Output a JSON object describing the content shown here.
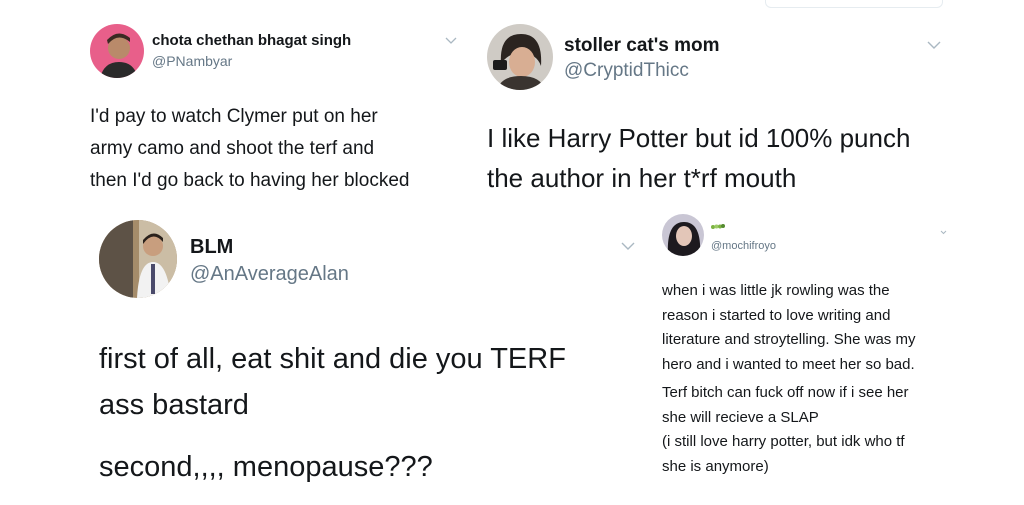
{
  "tweets": [
    {
      "name": "chota chethan bhagat singh",
      "handle": "@PNambyar",
      "lines": [
        "I'd pay to watch Clymer put on her",
        "army camo and shoot the terf and",
        "then I'd go back to having her blocked"
      ]
    },
    {
      "name": "stoller cat's mom",
      "handle": "@CryptidThicc",
      "lines": [
        "I like Harry Potter but id 100% punch",
        "the author in her t*rf mouth"
      ]
    },
    {
      "name": "BLM",
      "handle": "@AnAverageAlan",
      "lines": [
        "first of all, eat shit and die you TERF",
        "ass bastard",
        "second,,,, menopause???"
      ]
    },
    {
      "name": "",
      "handle": "@mochifroyo",
      "lines": [
        "when i was little jk rowling was the",
        "reason i started to love writing and",
        "literature and stroytelling. She was my",
        "hero and i wanted to meet her so bad.",
        "Terf bitch can fuck off now if i see her",
        "she will recieve a SLAP",
        "(i still love harry potter, but idk who tf",
        "she is anymore)"
      ]
    }
  ],
  "icons": {
    "chevron": "chevron-down-icon",
    "emoji": "caterpillar-emoji-icon"
  }
}
